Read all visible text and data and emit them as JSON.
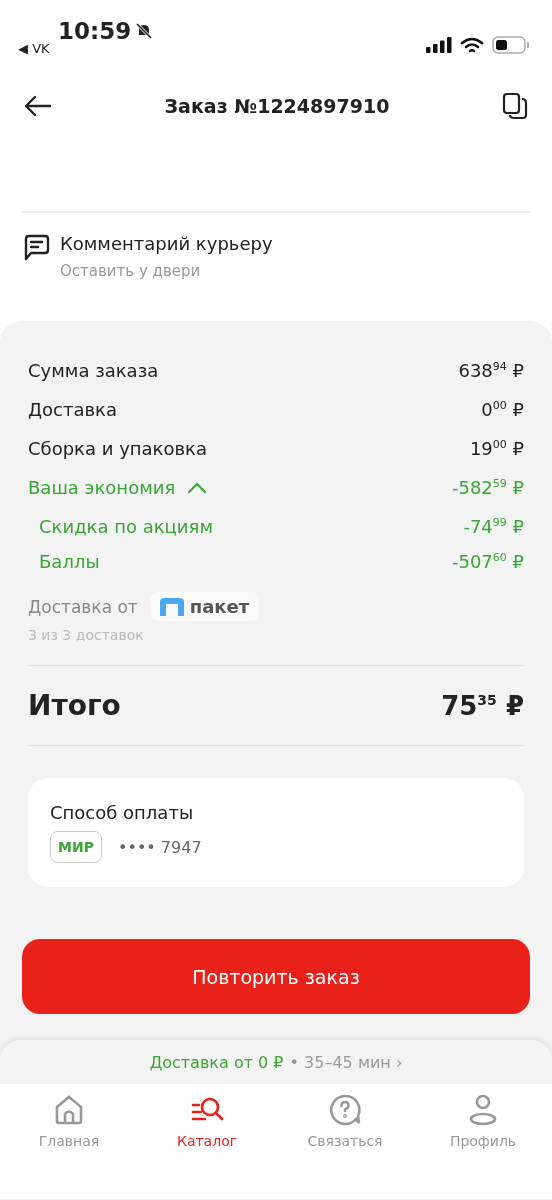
{
  "status_bar": {
    "time": "10:59",
    "back_app": "◀ VK"
  },
  "header": {
    "title": "Заказ №1224897910"
  },
  "comment": {
    "title": "Комментарий курьеру",
    "value": "Оставить у двери"
  },
  "summary": {
    "rows": [
      {
        "kind": "plain",
        "label": "Сумма заказа",
        "amount": "638$^{94}$ ₽"
      },
      {
        "kind": "plain",
        "label": "Доставка",
        "amount": "0$^{00}$ ₽"
      },
      {
        "kind": "plain",
        "label": "Сборка и упаковка",
        "amount": "19$^{00}$ ₽"
      },
      {
        "kind": "savings",
        "label": "Ваша экономия",
        "amount": "-582$^{59}$ ₽",
        "expanded": true,
        "children": [
          {
            "label": "Скидка по акциям",
            "amount": "-74$^{99}$ ₽"
          },
          {
            "label": "Баллы",
            "amount": "-507$^{60}$ ₽"
          }
        ]
      }
    ],
    "delivery_by": {
      "label": "Доставка от",
      "brand": "пакет",
      "note": "3 из 3 доставок"
    },
    "total": {
      "label": "Итого",
      "amount": "75$^{35}$ ₽"
    }
  },
  "payment": {
    "title": "Способ оплаты",
    "card_brand": "МИР",
    "card_number": "•••• 7947"
  },
  "repeat_button": "Повторить заказ",
  "delivery_banner": {
    "price": "Доставка от 0 ₽",
    "time": "• 35–45 мин ›"
  },
  "tabs": [
    {
      "kind": "home",
      "label": "Главная",
      "selected": false
    },
    {
      "kind": "catalog",
      "label": "Каталог",
      "selected": true
    },
    {
      "kind": "support",
      "label": "Связаться",
      "selected": false
    },
    {
      "kind": "profile",
      "label": "Профиль",
      "selected": false
    }
  ]
}
